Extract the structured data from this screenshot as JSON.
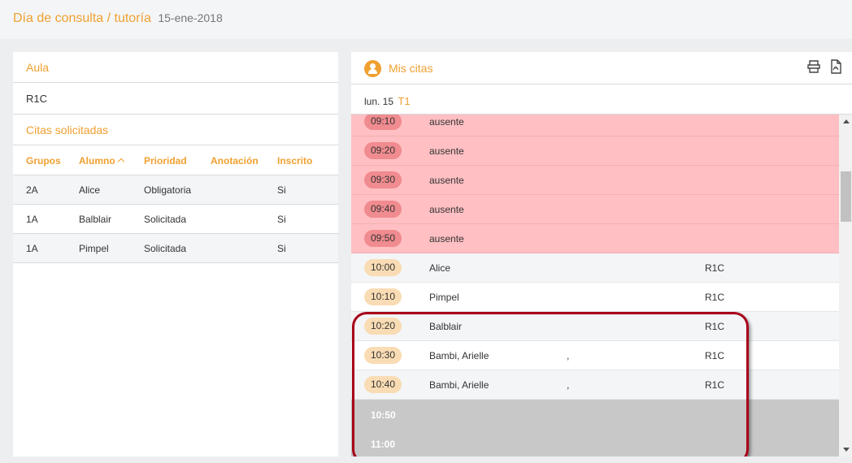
{
  "header": {
    "title": "Día de consulta / tutoría",
    "date": "15-ene-2018"
  },
  "left": {
    "aula_label": "Aula",
    "aula_value": "R1C",
    "citas_label": "Citas solicitadas",
    "columns": [
      "Grupos",
      "Alumno",
      "Prioridad",
      "Anotación",
      "Inscrito"
    ],
    "sort_icon": "chevron-up-icon",
    "rows": [
      {
        "grupo": "2A",
        "alumno": "Alice",
        "prioridad": "Obligatoria",
        "anotacion": "",
        "inscrito": "Si"
      },
      {
        "grupo": "1A",
        "alumno": "Balblair",
        "prioridad": "Solicitada",
        "anotacion": "",
        "inscrito": "Si"
      },
      {
        "grupo": "1A",
        "alumno": "Pimpel",
        "prioridad": "Solicitada",
        "anotacion": "",
        "inscrito": "Si"
      }
    ]
  },
  "right": {
    "title": "Mis citas",
    "icons": [
      "user-icon",
      "print-icon",
      "pdf-icon"
    ],
    "day": "lun. 15",
    "turn": "T1",
    "slots": [
      {
        "time": "09:10",
        "kind": "absent",
        "name": "ausente"
      },
      {
        "time": "09:20",
        "kind": "absent",
        "name": "ausente"
      },
      {
        "time": "09:30",
        "kind": "absent",
        "name": "ausente"
      },
      {
        "time": "09:40",
        "kind": "absent",
        "name": "ausente"
      },
      {
        "time": "09:50",
        "kind": "absent",
        "name": "ausente"
      },
      {
        "time": "10:00",
        "kind": "app",
        "name": "Alice",
        "sep": "",
        "room": "R1C"
      },
      {
        "time": "10:10",
        "kind": "app",
        "name": "Pimpel",
        "sep": "",
        "room": "R1C"
      },
      {
        "time": "10:20",
        "kind": "app",
        "name": "Balblair",
        "sep": "",
        "room": "R1C"
      },
      {
        "time": "10:30",
        "kind": "app",
        "name": "Bambi, Arielle",
        "sep": ",",
        "room": "R1C"
      },
      {
        "time": "10:40",
        "kind": "app",
        "name": "Bambi, Arielle",
        "sep": ",",
        "room": "R1C"
      },
      {
        "time": "10:50",
        "kind": "free",
        "name": ""
      },
      {
        "time": "11:00",
        "kind": "free",
        "name": ""
      }
    ]
  },
  "colors": {
    "accent": "#f0a030",
    "absent_bg": "#ffbfc3",
    "absent_pill": "#f08b8f",
    "app_pill": "#f9dcb4",
    "free_bg": "#c8c8c8",
    "highlight": "#a80018"
  }
}
